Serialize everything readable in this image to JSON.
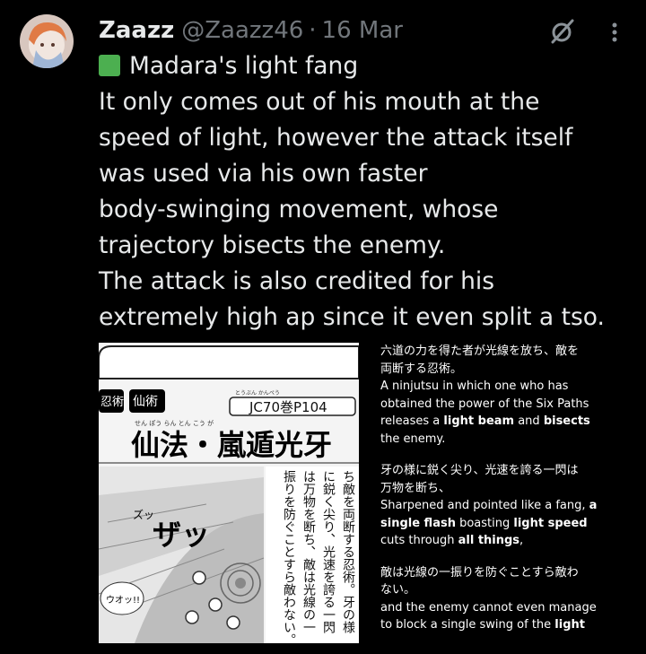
{
  "tweet": {
    "author_name": "Zaazz",
    "author_handle": "@Zaazz46",
    "separator": "·",
    "date": "16 Mar",
    "text_lines": [
      "Madara's light fang",
      "It only comes out of his mouth at the",
      "speed of light, however the attack itself",
      "was used via his own faster",
      "body-swinging movement, whose",
      "trajectory bisects the enemy.",
      "The attack is also credited for his",
      "extremely high ap since it even split a tso."
    ],
    "emoji": "green-square-emoji"
  },
  "manga": {
    "tab_left": "忍術",
    "tab_right": "仙術",
    "ref_ruby": "とうぶん   かんぺう",
    "ref": "JC70巻P104",
    "title_ruby": "せん   ぽう        らん   とん   こう   が",
    "title": "仙法・嵐遁光牙",
    "vertical_lines": [
      "ち敵を両断する忍術。牙の様",
      "に鋭く尖り、光速を誇る一閃",
      "は万物を断ち、敵は光線の一",
      "振りを防ぐことすら敵わない。"
    ],
    "sfx_main": "ザッ",
    "sfx_small": "ズッ",
    "bubble": "ウオッ!!"
  },
  "translation": {
    "p1_jp": [
      "六道の力を得た者が光線を放ち、敵を",
      "両断する忍術。"
    ],
    "p1_en_1": "A ninjutsu in which one who has",
    "p1_en_2": "obtained the power of the Six Paths",
    "p1_en_3a": "releases a ",
    "p1_en_3b": "light beam",
    "p1_en_3c": " and ",
    "p1_en_3d": "bisects",
    "p1_en_4": "the enemy.",
    "p2_jp": [
      "牙の様に鋭く尖り、光速を誇る一閃は",
      "万物を断ち、"
    ],
    "p2_en_1a": "Sharpened and pointed like a fang, ",
    "p2_en_1b": "a",
    "p2_en_2a": "single flash",
    "p2_en_2b": " boasting ",
    "p2_en_2c": "light speed",
    "p2_en_3a": "cuts through ",
    "p2_en_3b": "all things",
    "p2_en_3c": ",",
    "p3_jp": [
      "敵は光線の一振りを防ぐことすら敵わ",
      "ない。"
    ],
    "p3_en_1": "and the enemy cannot even manage",
    "p3_en_2a": "to block a single swing of the ",
    "p3_en_2b": "light"
  }
}
